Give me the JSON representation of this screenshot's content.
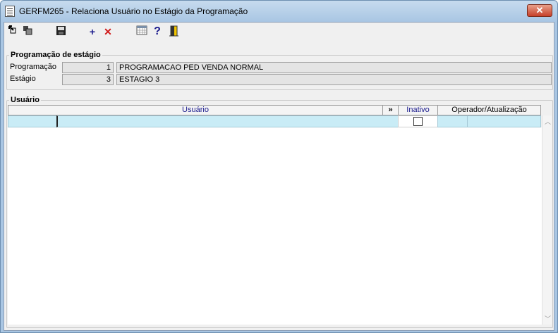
{
  "window": {
    "title": "GERFM265 - Relaciona Usuário no Estágio da Programação",
    "close_glyph": "✕"
  },
  "toolbar": {
    "icons": [
      "go-first-icon",
      "go-back-icon",
      "save-icon",
      "add-icon",
      "delete-icon",
      "calendar-grid-icon",
      "help-icon",
      "exit-door-icon"
    ],
    "add_glyph": "+",
    "delete_glyph": "✕",
    "help_glyph": "?"
  },
  "programacao_group": {
    "title": "Programação de estágio",
    "programacao_label": "Programação",
    "programacao_code": "1",
    "programacao_desc": "PROGRAMACAO PED VENDA NORMAL",
    "estagio_label": "Estágio",
    "estagio_code": "3",
    "estagio_desc": "ESTAGIO 3"
  },
  "usuario_group": {
    "title": "Usuário",
    "columns": {
      "usuario": "Usuário",
      "expand": "»",
      "inativo": "Inativo",
      "operador": "Operador/Atualização"
    },
    "rows": [
      {
        "codigo": "",
        "nome": "",
        "inativo": false,
        "operador": "",
        "atualizacao": ""
      }
    ]
  },
  "colors": {
    "grid_header_text": "#1a1a8c",
    "selected_row": "#c9ecf6",
    "title_bar": "#a9c6e3"
  }
}
